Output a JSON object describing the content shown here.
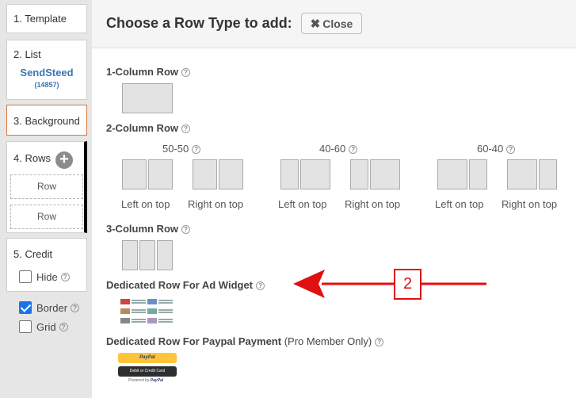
{
  "sidebar": {
    "steps": [
      {
        "label": "1. Template"
      },
      {
        "label": "2. List",
        "list_name": "SendSteed",
        "list_count": "(14857)"
      },
      {
        "label": "3. Background"
      },
      {
        "label": "4. Rows",
        "rows": [
          "Row",
          "Row"
        ]
      },
      {
        "label": "5. Credit",
        "hide_label": "Hide",
        "hide_checked": false
      }
    ],
    "border_label": "Border",
    "border_checked": true,
    "grid_label": "Grid",
    "grid_checked": false
  },
  "header": {
    "title": "Choose a Row Type to add:",
    "close_label": "Close"
  },
  "sections": {
    "one_col": "1-Column Row",
    "two_col": "2-Column Row",
    "three_col": "3-Column Row",
    "ad_widget": "Dedicated Row For Ad Widget",
    "paypal": "Dedicated Row For Paypal Payment",
    "paypal_note": "(Pro Member Only)"
  },
  "two_col_groups": [
    {
      "ratio": "50-50",
      "left": "Left on top",
      "right": "Right on top"
    },
    {
      "ratio": "40-60",
      "left": "Left on top",
      "right": "Right on top"
    },
    {
      "ratio": "60-40",
      "left": "Left on top",
      "right": "Right on top"
    }
  ],
  "paypal_widget": {
    "paypal_button": "PayPal",
    "card_button": "Debit or Credit Card",
    "powered_by": "Powered by",
    "powered_brand": "PayPal"
  },
  "annotation": {
    "number": "2"
  },
  "colors": {
    "accent_blue": "#3a76b4",
    "annotation_red": "#e01010",
    "active_step_border": "#e0763a"
  }
}
